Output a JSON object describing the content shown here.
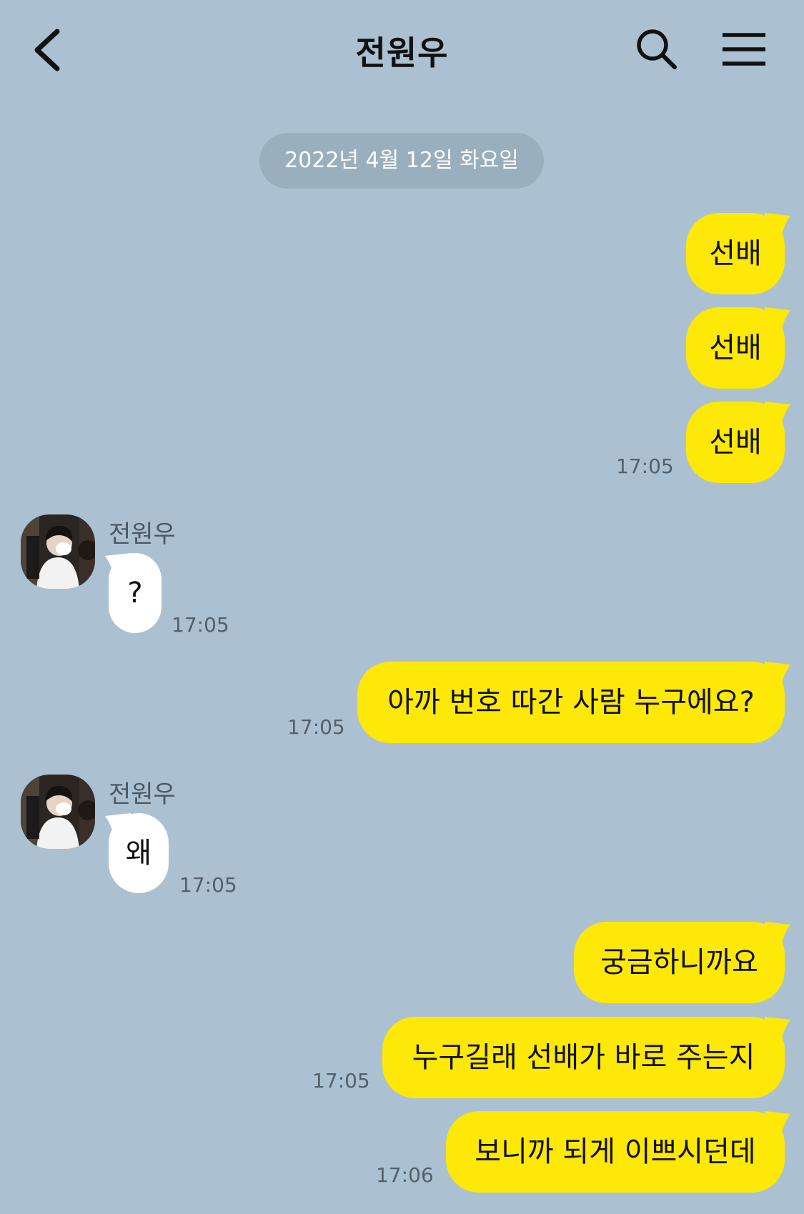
{
  "header": {
    "title": "전원우",
    "back_icon": "chevron-left-icon",
    "search_icon": "search-icon",
    "menu_icon": "menu-icon"
  },
  "date_divider": "2022년 4월 12일 화요일",
  "colors": {
    "background": "#abc1d1",
    "my_bubble": "#fde807",
    "their_bubble": "#ffffff",
    "date_pill": "#9aafbe"
  },
  "messages": [
    {
      "from": "me",
      "text": "선배"
    },
    {
      "from": "me",
      "text": "선배"
    },
    {
      "from": "me",
      "text": "선배",
      "time": "17:05"
    },
    {
      "from": "them",
      "sender": "전원우",
      "text": "?",
      "time": "17:05"
    },
    {
      "from": "me",
      "text": "아까 번호 따간 사람 누구에요?",
      "time": "17:05"
    },
    {
      "from": "them",
      "sender": "전원우",
      "text": "왜",
      "time": "17:05"
    },
    {
      "from": "me",
      "text": "궁금하니까요"
    },
    {
      "from": "me",
      "text": "누구길래 선배가 바로 주는지",
      "time": "17:05"
    },
    {
      "from": "me",
      "text": "보니까 되게 이쁘시던데",
      "time": "17:06"
    }
  ]
}
